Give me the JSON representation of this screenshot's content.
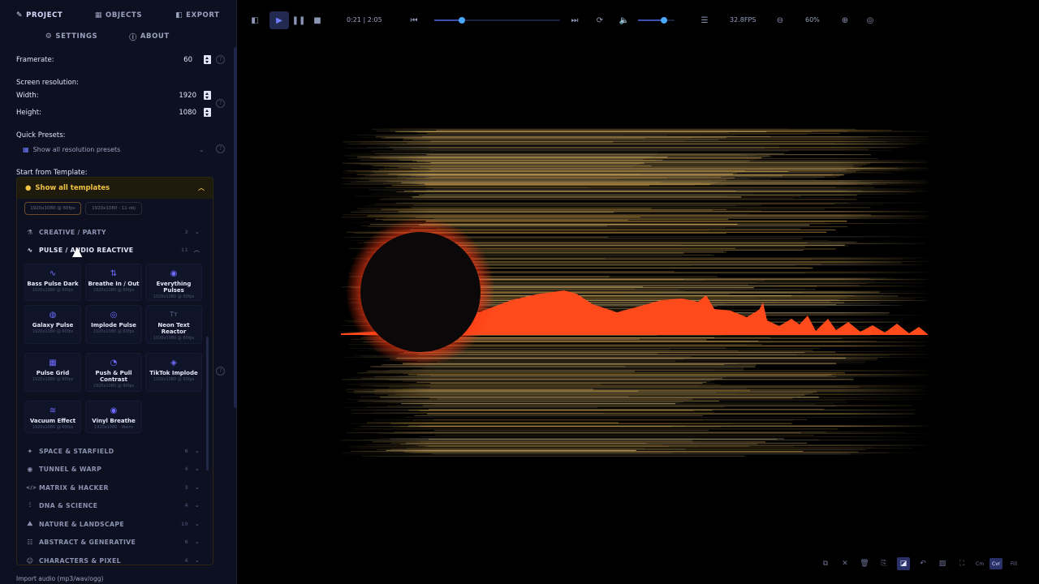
{
  "tabs_row1": [
    {
      "id": "project",
      "label": "PROJECT",
      "icon": "✎",
      "active": true
    },
    {
      "id": "objects",
      "label": "OBJECTS",
      "icon": "▦",
      "active": false
    },
    {
      "id": "export",
      "label": "EXPORT",
      "icon": "◧",
      "active": false
    }
  ],
  "tabs_row2": [
    {
      "id": "settings",
      "label": "SETTINGS",
      "icon": "⚙"
    },
    {
      "id": "about",
      "label": "ABOUT",
      "icon": "ⓘ"
    }
  ],
  "project": {
    "framerate_label": "Framerate:",
    "framerate_value": "60",
    "resolution_label": "Screen resolution:",
    "width_label": "Width:",
    "width_value": "1920",
    "height_label": "Height:",
    "height_value": "1080",
    "quick_presets_label": "Quick Presets:",
    "presets_selector": "Show all resolution presets",
    "template_label": "Start from Template:",
    "templates_toggle": "Show all templates",
    "bottom_partial": "Import audio (mp3/wav/ogg)"
  },
  "mini_cards": [
    "1920x1080 @ 60fps",
    "1920x1080 - 11 obj"
  ],
  "categories_top": [
    {
      "label": "CREATIVE / PARTY",
      "icon": "⚗",
      "count": "3",
      "open": false
    },
    {
      "label": "PULSE / AUDIO REACTIVE",
      "icon": "∿",
      "count": "11",
      "open": true
    }
  ],
  "pulse_templates": [
    {
      "name": "Bass Pulse Dark",
      "sub": "1920x1080 @ 60fps",
      "icon": "∿"
    },
    {
      "name": "Breathe In / Out",
      "sub": "1920x1080 @ 60fps",
      "icon": "⇅"
    },
    {
      "name": "Everything Pulses",
      "sub": "1920x1080 @ 60fps",
      "icon": "◉"
    },
    {
      "name": "Galaxy Pulse",
      "sub": "1920x1080 @ 60fps",
      "icon": "◍"
    },
    {
      "name": "Implode Pulse",
      "sub": "1920x1080 @ 60fps",
      "icon": "◎"
    },
    {
      "name": "Neon Text Reactor",
      "sub": "1920x1080 @ 60fps",
      "icon": "Tт"
    },
    {
      "name": "Pulse Grid",
      "sub": "1920x1080 @ 60fps",
      "icon": "▦"
    },
    {
      "name": "Push & Pull Contrast",
      "sub": "1920x1080 @ 60fps",
      "icon": "◔"
    },
    {
      "name": "TikTok Implode",
      "sub": "1920x1080 @ 60fps",
      "icon": "◈"
    },
    {
      "name": "Vacuum Effect",
      "sub": "1920x1080 @ 60fps",
      "icon": "≋"
    },
    {
      "name": "Vinyl Breathe",
      "sub": "1920x1080 - Warm",
      "icon": "◉"
    }
  ],
  "categories_bottom": [
    {
      "label": "SPACE & STARFIELD",
      "icon": "✦",
      "count": "6"
    },
    {
      "label": "TUNNEL & WARP",
      "icon": "◉",
      "count": "4"
    },
    {
      "label": "MATRIX & HACKER",
      "icon": "</>",
      "count": "3"
    },
    {
      "label": "DNA & SCIENCE",
      "icon": "⫶",
      "count": "4"
    },
    {
      "label": "NATURE & LANDSCAPE",
      "icon": "⛰",
      "count": "10"
    },
    {
      "label": "ABSTRACT & GENERATIVE",
      "icon": "☷",
      "count": "6"
    },
    {
      "label": "CHARACTERS & PIXEL",
      "icon": "☺",
      "count": "4"
    }
  ],
  "toolbar": {
    "time": "0:21 | 2:05",
    "fps": "32.8FPS",
    "zoom": "60%",
    "timeline_progress": 0.22,
    "volume_level": 0.7
  },
  "bottom_tools": {
    "cmn_label": "Cm",
    "cvr_label": "Cvr",
    "fill_label": "Fill"
  },
  "colors": {
    "accent": "#6f7dff",
    "template_header": "#f1c342",
    "glow": "#ff3a14",
    "wave": "#ff4a1c"
  }
}
